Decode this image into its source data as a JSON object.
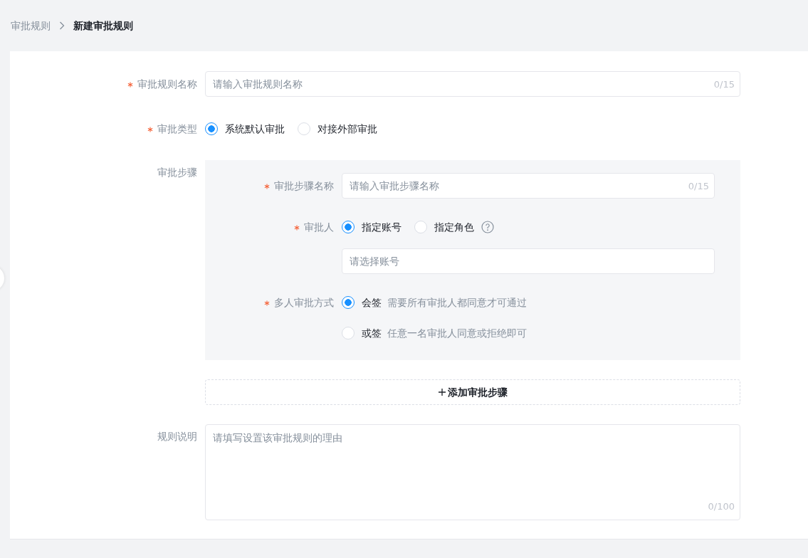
{
  "breadcrumb": [
    {
      "label": "审批规则",
      "current": false
    },
    {
      "label": "新建审批规则",
      "current": true
    }
  ],
  "form": {
    "rule_name": {
      "label": "审批规则名称",
      "required": true,
      "placeholder": "请输入审批规则名称",
      "counter": "0/15"
    },
    "approval_type": {
      "label": "审批类型",
      "required": true,
      "options": [
        {
          "label": "系统默认审批",
          "selected": true
        },
        {
          "label": "对接外部审批",
          "selected": false
        }
      ]
    },
    "steps": {
      "label": "审批步骤",
      "required": false,
      "step_name": {
        "label": "审批步骤名称",
        "required": true,
        "placeholder": "请输入审批步骤名称",
        "counter": "0/15"
      },
      "approver": {
        "label": "审批人",
        "required": true,
        "options": [
          {
            "label": "指定账号",
            "selected": true
          },
          {
            "label": "指定角色",
            "selected": false
          }
        ],
        "account_placeholder": "请选择账号"
      },
      "multi_method": {
        "label": "多人审批方式",
        "required": true,
        "options": [
          {
            "label": "会签",
            "description": "需要所有审批人都同意才可通过",
            "selected": true
          },
          {
            "label": "或签",
            "description": "任意一名审批人同意或拒绝即可",
            "selected": false
          }
        ]
      }
    },
    "add_step_button": {
      "label": "添加审批步骤"
    },
    "description": {
      "label": "规则说明",
      "required": false,
      "placeholder": "请填写设置该审批规则的理由",
      "counter": "0/100"
    }
  }
}
